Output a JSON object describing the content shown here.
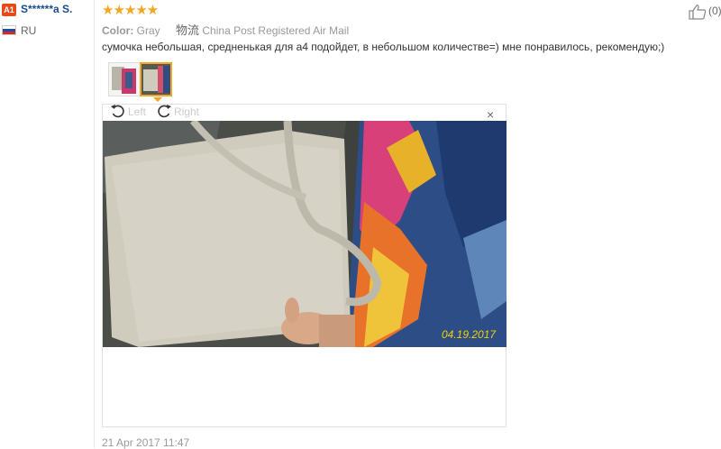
{
  "reviewer": {
    "level_badge": "A1",
    "name": "S******a S.",
    "country": "RU"
  },
  "rating": {
    "stars": 5,
    "star_glyphs": "★★★★★"
  },
  "feedback": {
    "like_count": "(0)"
  },
  "order": {
    "color_label": "Color:",
    "color_value": "Gray",
    "shipping_icon_text": "物流",
    "shipping_value": "China Post Registered Air Mail"
  },
  "review_text": "сумочка небольшая, средненькая для а4 подойдет, в небольшом количестве=) мне понравилось, рекомендую;)",
  "viewer": {
    "rotate_left_label": "Left",
    "rotate_right_label": "Right",
    "close_glyph": "×",
    "photo_date": "04.19.2017"
  },
  "timestamp": "21 Apr 2017 11:47"
}
